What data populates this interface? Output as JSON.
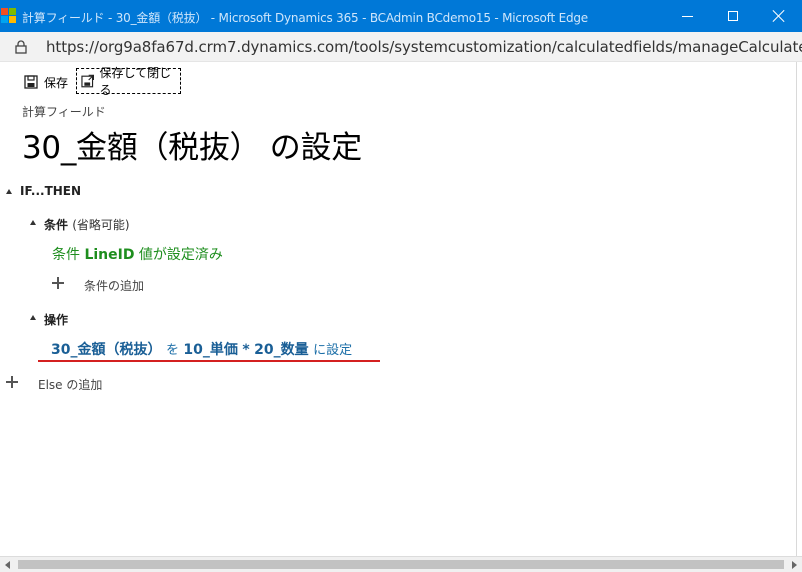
{
  "window": {
    "title": "計算フィールド - 30_金額（税抜） - Microsoft Dynamics 365 - BCAdmin BCdemo15 - Microsoft Edge",
    "controls": {
      "minimize": "minimize",
      "maximize": "maximize",
      "close": "close"
    }
  },
  "address_bar": {
    "url": "https://org9a8fa67d.crm7.dynamics.com/tools/systemcustomization/calculatedfields/manageCalculate..."
  },
  "toolbar": {
    "save_label": "保存",
    "save_close_label": "保存して閉じる"
  },
  "header": {
    "subtitle": "計算フィールド",
    "title": "30_金額（税抜） の設定"
  },
  "editor": {
    "if_then_label": "IF...THEN",
    "conditions": {
      "heading": "条件",
      "note": "(省略可能)",
      "prefix": "条件",
      "field": "LineID",
      "suffix": "値が設定済み",
      "add_label": "条件の追加"
    },
    "actions": {
      "heading": "操作",
      "target": "30_金額（税抜）",
      "op_to": "を",
      "operand1": "10_単価",
      "operator": "*",
      "operand2": "20_数量",
      "suffix": "に設定"
    },
    "add_else_label": "Else の追加"
  },
  "colors": {
    "titlebar": "#0078d7",
    "condition_text": "#1e8e1e",
    "action_text": "#1c6fa8",
    "highlight_underline": "#d42020"
  }
}
